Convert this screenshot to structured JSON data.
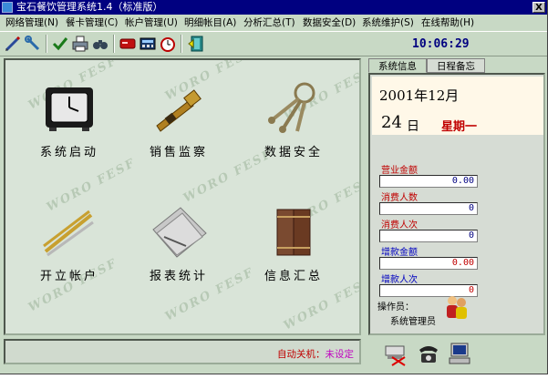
{
  "window": {
    "title": "宝石餐饮管理系统1.4（标准版）",
    "close_label": "X"
  },
  "menu": [
    "网络管理(N)",
    "餐卡管理(C)",
    "帐户管理(U)",
    "明细帐目(A)",
    "分析汇总(T)",
    "数据安全(D)",
    "系统维护(S)",
    "在线帮助(H)"
  ],
  "toolbar": {
    "icons": [
      "pen-icon",
      "wrench-icon",
      "check-icon",
      "printer-icon",
      "binoculars-icon",
      "card-red-icon",
      "calculator-icon",
      "alarm-clock-icon",
      "exit-door-icon"
    ]
  },
  "clock": "10:06:29",
  "functions": [
    {
      "label": "系统启动",
      "icon": "alarm-clock-icon"
    },
    {
      "label": "销售监察",
      "icon": "telescope-icon"
    },
    {
      "label": "数据安全",
      "icon": "keys-icon"
    },
    {
      "label": "开立帐户",
      "icon": "cutlery-icon"
    },
    {
      "label": "报表统计",
      "icon": "papers-icon"
    },
    {
      "label": "信息汇总",
      "icon": "books-icon"
    }
  ],
  "watermark_text": "WORO FESF",
  "side_tabs": [
    "系统信息",
    "日程备忘"
  ],
  "date": {
    "year_month": "2001年12月",
    "day": "24",
    "day_suffix": "日",
    "weekday": "星期一"
  },
  "stats": [
    {
      "label": "营业金额",
      "value": "0.00",
      "label_color": "#c00000",
      "value_color": "#000080"
    },
    {
      "label": "消费人数",
      "value": "0",
      "label_color": "#c00000",
      "value_color": "#000080"
    },
    {
      "label": "消费人次",
      "value": "0",
      "label_color": "#c00000",
      "value_color": "#000080"
    },
    {
      "label": "增款金额",
      "value": "0.00",
      "label_color": "#0000c0",
      "value_color": "#c00000"
    },
    {
      "label": "增款人次",
      "value": "0",
      "label_color": "#0000c0",
      "value_color": "#c00000"
    }
  ],
  "operator": {
    "label": "操作员：",
    "name": "系统管理员"
  },
  "status": {
    "auto_shutdown_label": "自动关机：",
    "auto_shutdown_value": "未设定"
  },
  "bottom_buttons": [
    "disk-cancel-icon",
    "telephone-icon",
    "computer-icon"
  ]
}
